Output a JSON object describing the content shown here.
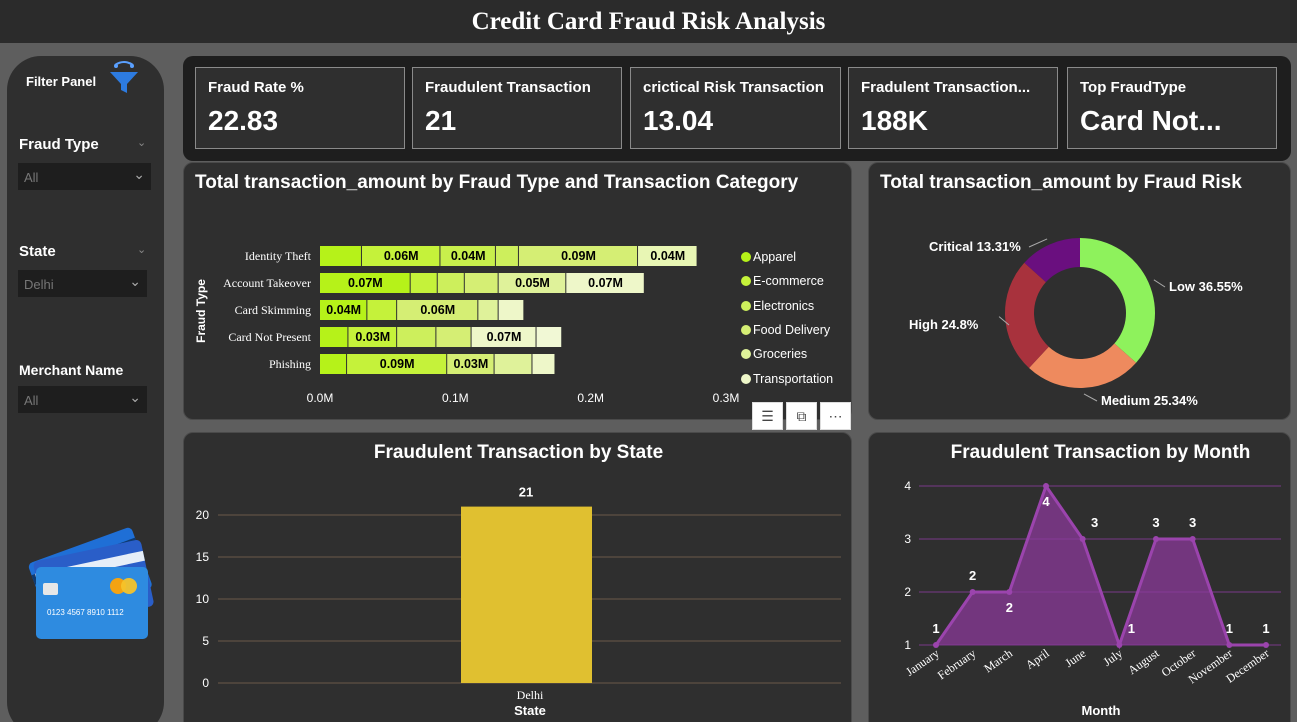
{
  "title": "Credit Card Fraud Risk Analysis",
  "filter_panel": {
    "title": "Filter Panel",
    "filters": [
      {
        "label": "Fraud Type",
        "value": "All"
      },
      {
        "label": "State",
        "value": "Delhi"
      },
      {
        "label": "Merchant Name",
        "value": "All"
      }
    ],
    "card_text": "0123  4567  8910  1112"
  },
  "kpis": [
    {
      "label": "Fraud Rate %",
      "value": "22.83"
    },
    {
      "label": "Fraudulent Transaction",
      "value": "21"
    },
    {
      "label": "crictical Risk Transaction",
      "value": "13.04"
    },
    {
      "label": "Fradulent Transaction...",
      "value": "188K"
    },
    {
      "label": "Top FraudType",
      "value": "Card Not..."
    }
  ],
  "visual_header_icons": [
    "filter-icon",
    "focus-mode-icon",
    "more-options-icon"
  ],
  "chart_data": [
    {
      "type": "bar",
      "orientation": "horizontal-stacked",
      "title": "Total transaction_amount by Fraud Type and Transaction Category",
      "ylabel": "Fraud Type",
      "xlabel": "",
      "xlim": [
        0,
        0.3
      ],
      "xticks": [
        "0.0M",
        "0.1M",
        "0.2M",
        "0.3M"
      ],
      "categories": [
        "Identity Theft",
        "Account Takeover",
        "Card Skimming",
        "Card Not Present",
        "Phishing"
      ],
      "segments": [
        [
          {
            "v": 0.031,
            "c": "#b6f219",
            "l": ""
          },
          {
            "v": 0.058,
            "c": "#c5f23a",
            "l": "0.06M"
          },
          {
            "v": 0.041,
            "c": "#c8ef4c",
            "l": "0.04M"
          },
          {
            "v": 0.017,
            "c": "#cdef5c",
            "l": ""
          },
          {
            "v": 0.088,
            "c": "#d5ee74",
            "l": "0.09M"
          },
          {
            "v": 0.044,
            "c": "#e8f6b4",
            "l": "0.04M"
          },
          {
            "v": 0.0,
            "c": "#ffffff",
            "l": ""
          }
        ],
        [
          {
            "v": 0.067,
            "c": "#b6f219",
            "l": "0.07M"
          },
          {
            "v": 0.02,
            "c": "#c5f23a",
            "l": ""
          },
          {
            "v": 0.02,
            "c": "#cdef5c",
            "l": ""
          },
          {
            "v": 0.025,
            "c": "#d5ee74",
            "l": ""
          },
          {
            "v": 0.05,
            "c": "#dff29a",
            "l": "0.05M"
          },
          {
            "v": 0.058,
            "c": "#eef7c9",
            "l": "0.07M"
          }
        ],
        [
          {
            "v": 0.035,
            "c": "#b6f219",
            "l": "0.04M"
          },
          {
            "v": 0.022,
            "c": "#c5f23a",
            "l": ""
          },
          {
            "v": 0.06,
            "c": "#d5ee74",
            "l": "0.06M"
          },
          {
            "v": 0.015,
            "c": "#dff29a",
            "l": ""
          },
          {
            "v": 0.019,
            "c": "#eef7c9",
            "l": ""
          }
        ],
        [
          {
            "v": 0.021,
            "c": "#b6f219",
            "l": ""
          },
          {
            "v": 0.036,
            "c": "#c5f23a",
            "l": "0.03M"
          },
          {
            "v": 0.029,
            "c": "#cdef5c",
            "l": ""
          },
          {
            "v": 0.026,
            "c": "#d5ee74",
            "l": ""
          },
          {
            "v": 0.048,
            "c": "#eef7c9",
            "l": "0.07M"
          },
          {
            "v": 0.019,
            "c": "#f1f8d5",
            "l": ""
          }
        ],
        [
          {
            "v": 0.02,
            "c": "#b6f219",
            "l": ""
          },
          {
            "v": 0.074,
            "c": "#c5f23a",
            "l": "0.09M"
          },
          {
            "v": 0.035,
            "c": "#d5ee74",
            "l": "0.03M"
          },
          {
            "v": 0.028,
            "c": "#dff29a",
            "l": ""
          },
          {
            "v": 0.017,
            "c": "#eef7c9",
            "l": ""
          }
        ]
      ],
      "legend": [
        {
          "name": "Apparel",
          "color": "#b6f219"
        },
        {
          "name": "E-commerce",
          "color": "#c5f23a"
        },
        {
          "name": "Electronics",
          "color": "#cdef5c"
        },
        {
          "name": "Food Delivery",
          "color": "#d5ee74"
        },
        {
          "name": "Groceries",
          "color": "#dff29a"
        },
        {
          "name": "Transportation",
          "color": "#eef7c9"
        }
      ]
    },
    {
      "type": "pie",
      "variant": "donut",
      "title": "Total transaction_amount by Fraud Risk",
      "slices": [
        {
          "label": "Low 36.55%",
          "value": 36.55,
          "color": "#8ef25c"
        },
        {
          "label": "Medium 25.34%",
          "value": 25.34,
          "color": "#ee8a5e"
        },
        {
          "label": "High 24.8%",
          "value": 24.8,
          "color": "#a8323d"
        },
        {
          "label": "Critical 13.31%",
          "value": 13.31,
          "color": "#6a0f7f"
        }
      ]
    },
    {
      "type": "bar",
      "title": "Fraudulent Transaction by State",
      "xlabel": "State",
      "categories": [
        "Delhi"
      ],
      "values": [
        21
      ],
      "data_labels": [
        "21"
      ],
      "ylim": [
        0,
        25
      ],
      "yticks": [
        "0",
        "5",
        "10",
        "15",
        "20"
      ],
      "color": "#e0c030"
    },
    {
      "type": "area",
      "title": "Fraudulent Transaction by Month",
      "xlabel": "Month",
      "categories": [
        "January",
        "February",
        "March",
        "April",
        "June",
        "July",
        "August",
        "October",
        "November",
        "December"
      ],
      "values": [
        1,
        2,
        2,
        4,
        3,
        1,
        3,
        3,
        1,
        1
      ],
      "data_labels": [
        "1",
        "2",
        "2",
        "4",
        "3",
        "1",
        "3",
        "3",
        "1",
        "1"
      ],
      "ylim": [
        1,
        4
      ],
      "yticks": [
        "1",
        "2",
        "3",
        "4"
      ],
      "color": "#8b3a9a"
    }
  ]
}
